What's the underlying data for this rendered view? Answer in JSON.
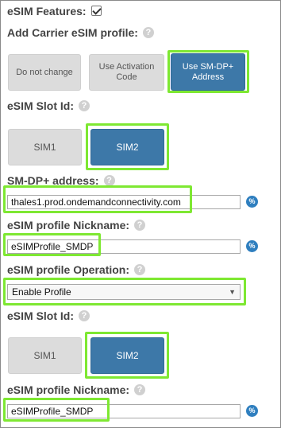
{
  "esim_features": {
    "label": "eSIM Features:",
    "checked": true
  },
  "add_profile": {
    "label": "Add Carrier eSIM profile:",
    "options": [
      "Do not change",
      "Use Activation Code",
      "Use SM-DP+ Address"
    ],
    "selected": "Use SM-DP+ Address"
  },
  "slot1": {
    "label": "eSIM Slot Id:",
    "options": [
      "SIM1",
      "SIM2"
    ],
    "selected": "SIM2"
  },
  "smdp": {
    "label": "SM-DP+ address:",
    "value": "thales1.prod.ondemandconnectivity.com"
  },
  "nickname1": {
    "label": "eSIM profile Nickname:",
    "value": "eSIMProfile_SMDP"
  },
  "operation": {
    "label": "eSIM profile Operation:",
    "value": "Enable Profile"
  },
  "slot2": {
    "label": "eSIM Slot Id:",
    "options": [
      "SIM1",
      "SIM2"
    ],
    "selected": "SIM2"
  },
  "nickname2": {
    "label": "eSIM profile Nickname:",
    "value": "eSIMProfile_SMDP"
  },
  "var_icon": "%",
  "colors": {
    "highlight": "#7ee832",
    "selected_button": "#3d78a8",
    "unselected_button": "#dcdcdc"
  }
}
